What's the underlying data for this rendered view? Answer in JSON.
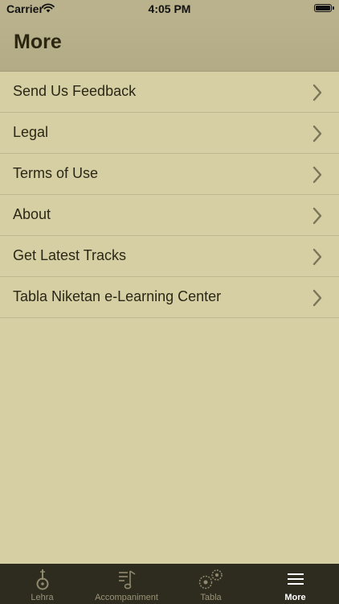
{
  "status_bar": {
    "carrier": "Carrier",
    "time": "4:05 PM",
    "battery_level": 1.0
  },
  "header": {
    "title": "More"
  },
  "menu": {
    "items": [
      {
        "label": "Send Us Feedback"
      },
      {
        "label": "Legal"
      },
      {
        "label": "Terms of Use"
      },
      {
        "label": "About"
      },
      {
        "label": "Get Latest Tracks"
      },
      {
        "label": "Tabla Niketan e-Learning Center"
      }
    ]
  },
  "tab_bar": {
    "tabs": [
      {
        "label": "Lehra",
        "icon": "sitar-icon",
        "active": false
      },
      {
        "label": "Accompaniment",
        "icon": "music-list-icon",
        "active": false
      },
      {
        "label": "Tabla",
        "icon": "tabla-icon",
        "active": false
      },
      {
        "label": "More",
        "icon": "hamburger-menu-icon",
        "active": true
      }
    ]
  },
  "colors": {
    "background": "#d6cfa3",
    "header": "#b9b28c",
    "tab_bar": "#2e2b1f",
    "active_tab": "#ffffff",
    "inactive_tab": "#9a9478"
  }
}
